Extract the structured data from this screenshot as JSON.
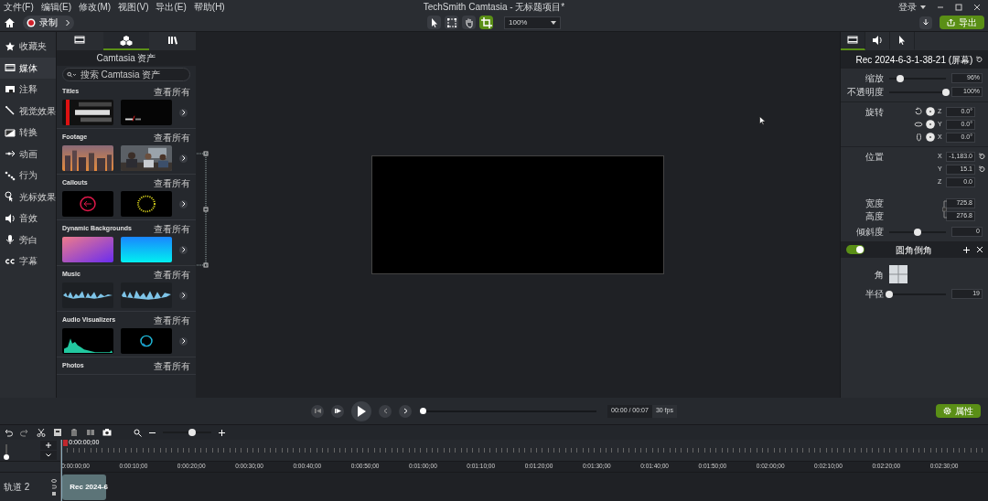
{
  "menu": [
    "文件(F)",
    "编辑(E)",
    "修改(M)",
    "视图(V)",
    "导出(E)",
    "帮助(H)"
  ],
  "window": {
    "title": "TechSmith Camtasia - 无标题项目*",
    "login": "登录"
  },
  "toolbar": {
    "record": "录制",
    "tools": [
      {
        "selected": false
      },
      {
        "selected": false
      },
      {
        "selected": false
      },
      {
        "selected": true
      }
    ],
    "zoom": "100%",
    "export": "导出"
  },
  "nav": [
    {
      "label": "收藏夹",
      "selected": false
    },
    {
      "label": "媒体",
      "selected": true
    },
    {
      "label": "注释",
      "selected": false
    },
    {
      "label": "视觉效果",
      "selected": false
    },
    {
      "label": "转换",
      "selected": false
    },
    {
      "label": "动画",
      "selected": false
    },
    {
      "label": "行为",
      "selected": false
    },
    {
      "label": "光标效果",
      "selected": false
    },
    {
      "label": "音效",
      "selected": false
    },
    {
      "label": "旁白",
      "selected": false
    },
    {
      "label": "字幕",
      "selected": false
    }
  ],
  "assets": {
    "tabs": [
      {
        "selected": false
      },
      {
        "selected": true
      },
      {
        "selected": false
      }
    ],
    "title": "Camtasia 资产",
    "search": {
      "placeholder": "搜索 Camtasia 资产"
    },
    "categories": [
      {
        "kind": "titles",
        "title": "Titles",
        "link": "查看所有"
      },
      {
        "kind": "footage",
        "title": "Footage",
        "link": "查看所有"
      },
      {
        "kind": "callouts",
        "title": "Callouts",
        "link": "查看所有"
      },
      {
        "kind": "backgrounds",
        "title": "Dynamic Backgrounds",
        "link": "查看所有"
      },
      {
        "kind": "music",
        "title": "Music",
        "link": "查看所有"
      },
      {
        "kind": "visualizers",
        "title": "Audio Visualizers",
        "link": "查看所有"
      },
      {
        "kind": "photos",
        "title": "Photos",
        "link": "查看所有"
      }
    ]
  },
  "properties": {
    "tabs": [
      {
        "selected": true
      },
      {
        "selected": false
      },
      {
        "selected": false
      }
    ],
    "title": "Rec 2024-6-3-1-38-21 (屏幕)",
    "sliders": [
      {
        "label": "缩放",
        "level": 0.2,
        "value": "96%"
      },
      {
        "label": "不透明度",
        "level": 1,
        "value": "100%"
      }
    ],
    "rotation": {
      "label": "旋转",
      "axes": [
        {
          "axis": "Z",
          "value": "0.0°"
        },
        {
          "axis": "Y",
          "value": "0.0°"
        },
        {
          "axis": "X",
          "value": "0.0°"
        }
      ]
    },
    "position": {
      "label": "位置",
      "axes": [
        {
          "axis": "X",
          "value": "-1,183.0",
          "reset": true
        },
        {
          "axis": "Y",
          "value": "15.1",
          "reset": true
        },
        {
          "axis": "Z",
          "value": "0.0",
          "reset": false
        }
      ]
    },
    "size": [
      {
        "label": "宽度",
        "value": "725.8"
      },
      {
        "label": "高度",
        "value": "276.8"
      }
    ],
    "skew": {
      "label": "倾斜度",
      "level": 0.5,
      "value": "0"
    },
    "effect": {
      "on": true,
      "title": "圆角倒角",
      "corner_label": "角",
      "radius": {
        "label": "半径",
        "level": 0,
        "value": "19"
      }
    }
  },
  "transport": {
    "progress": {
      "level": 0
    },
    "time": "00:00 / 00:07",
    "fps": "30 fps",
    "properties_button": "属性"
  },
  "timeline": {
    "zoom": {
      "level": 0.6
    },
    "track_height": {
      "level": 0
    },
    "playhead": "0:00:00;00",
    "ruler": [
      "0:00:00;00",
      "0:00:10;00",
      "0:00:20;00",
      "0:00:30;00",
      "0:00:40;00",
      "0:00:50;00",
      "0:01:00;00",
      "0:01:10;00",
      "0:01:20;00",
      "0:01:30;00",
      "0:01:40;00",
      "0:01:50;00",
      "0:02:00;00",
      "0:02:10;00",
      "0:02:20;00",
      "0:02:30;00"
    ],
    "tracks": [
      {
        "name": "轨道 2",
        "clip": "Rec 2024-6"
      }
    ]
  }
}
